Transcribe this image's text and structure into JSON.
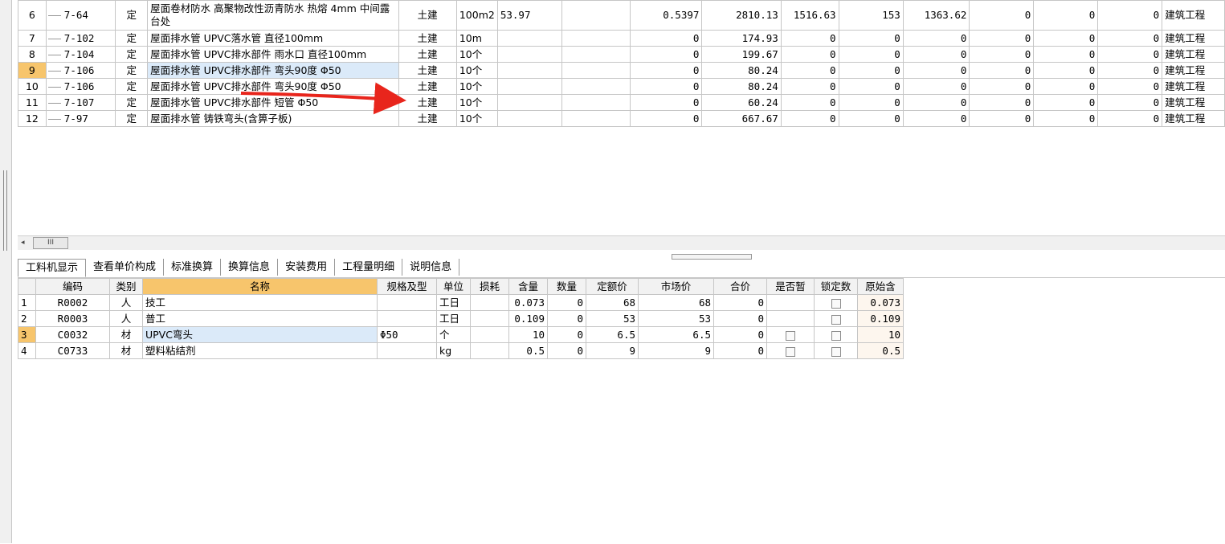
{
  "top_grid": {
    "rows": [
      {
        "rn": "6",
        "code": "7-64",
        "type": "定",
        "name": "屋面卷材防水 高聚物改性沥青防水 热熔 4mm 中间露台处",
        "cat": "土建",
        "unit": "100m2",
        "qty": "53.97",
        "c8": "",
        "c9": "0.5397",
        "c10": "2810.13",
        "c11": "1516.63",
        "c12": "153",
        "c13": "1363.62",
        "c14": "0",
        "c15": "0",
        "c16": "0",
        "major": "建筑工程"
      },
      {
        "rn": "7",
        "code": "7-102",
        "type": "定",
        "name": "屋面排水管 UPVC落水管 直径100mm",
        "cat": "土建",
        "unit": "10m",
        "qty": "",
        "c8": "",
        "c9": "0",
        "c10": "174.93",
        "c11": "0",
        "c12": "0",
        "c13": "0",
        "c14": "0",
        "c15": "0",
        "c16": "0",
        "major": "建筑工程"
      },
      {
        "rn": "8",
        "code": "7-104",
        "type": "定",
        "name": "屋面排水管 UPVC排水部件 雨水口 直径100mm",
        "cat": "土建",
        "unit": "10个",
        "qty": "",
        "c8": "",
        "c9": "0",
        "c10": "199.67",
        "c11": "0",
        "c12": "0",
        "c13": "0",
        "c14": "0",
        "c15": "0",
        "c16": "0",
        "major": "建筑工程"
      },
      {
        "rn": "9",
        "code": "7-106",
        "type": "定",
        "name": "屋面排水管 UPVC排水部件 弯头90度 Φ50",
        "cat": "土建",
        "unit": "10个",
        "qty": "",
        "c8": "",
        "c9": "0",
        "c10": "80.24",
        "c11": "0",
        "c12": "0",
        "c13": "0",
        "c14": "0",
        "c15": "0",
        "c16": "0",
        "major": "建筑工程"
      },
      {
        "rn": "10",
        "code": "7-106",
        "type": "定",
        "name": "屋面排水管 UPVC排水部件 弯头90度 Φ50",
        "cat": "土建",
        "unit": "10个",
        "qty": "",
        "c8": "",
        "c9": "0",
        "c10": "80.24",
        "c11": "0",
        "c12": "0",
        "c13": "0",
        "c14": "0",
        "c15": "0",
        "c16": "0",
        "major": "建筑工程"
      },
      {
        "rn": "11",
        "code": "7-107",
        "type": "定",
        "name": "屋面排水管 UPVC排水部件 短管 Φ50",
        "cat": "土建",
        "unit": "10个",
        "qty": "",
        "c8": "",
        "c9": "0",
        "c10": "60.24",
        "c11": "0",
        "c12": "0",
        "c13": "0",
        "c14": "0",
        "c15": "0",
        "c16": "0",
        "major": "建筑工程"
      },
      {
        "rn": "12",
        "code": "7-97",
        "type": "定",
        "name": "屋面排水管 铸铁弯头(含箅子板)",
        "cat": "土建",
        "unit": "10个",
        "qty": "",
        "c8": "",
        "c9": "0",
        "c10": "667.67",
        "c11": "0",
        "c12": "0",
        "c13": "0",
        "c14": "0",
        "c15": "0",
        "c16": "0",
        "major": "建筑工程"
      }
    ]
  },
  "scrollbar": {
    "thumb_label": "III",
    "left_arrow": "◂"
  },
  "tabs": [
    "工料机显示",
    "查看单价构成",
    "标准换算",
    "换算信息",
    "安装费用",
    "工程量明细",
    "说明信息"
  ],
  "bottom_grid": {
    "headers": [
      "",
      "编码",
      "类别",
      "名称",
      "规格及型",
      "单位",
      "损耗",
      "含量",
      "数量",
      "定额价",
      "市场价",
      "合价",
      "是否暂",
      "锁定数",
      "原始含"
    ],
    "rows": [
      {
        "rn": "1",
        "code": "R0002",
        "cat": "人",
        "name": "技工",
        "spec": "",
        "unit": "工日",
        "loss": "",
        "content": "0.073",
        "qty": "0",
        "quota": "68",
        "market": "68",
        "total": "0",
        "temp": false,
        "lock": true,
        "orig": "0.073"
      },
      {
        "rn": "2",
        "code": "R0003",
        "cat": "人",
        "name": "普工",
        "spec": "",
        "unit": "工日",
        "loss": "",
        "content": "0.109",
        "qty": "0",
        "quota": "53",
        "market": "53",
        "total": "0",
        "temp": false,
        "lock": false,
        "orig": "0.109"
      },
      {
        "rn": "3",
        "code": "C0032",
        "cat": "材",
        "name": "UPVC弯头",
        "spec": "Φ50",
        "unit": "个",
        "loss": "",
        "content": "10",
        "qty": "0",
        "quota": "6.5",
        "market": "6.5",
        "total": "0",
        "temp": true,
        "lock": true,
        "orig": "10"
      },
      {
        "rn": "4",
        "code": "C0733",
        "cat": "材",
        "name": "塑料粘结剂",
        "spec": "",
        "unit": "kg",
        "loss": "",
        "content": "0.5",
        "qty": "0",
        "quota": "9",
        "market": "9",
        "total": "0",
        "temp": true,
        "lock": true,
        "orig": "0.5"
      }
    ]
  },
  "colors": {
    "selected_row_header": "#f7c56c",
    "selected_cell": "#dbeaf9",
    "arrow": "#e8251c"
  }
}
